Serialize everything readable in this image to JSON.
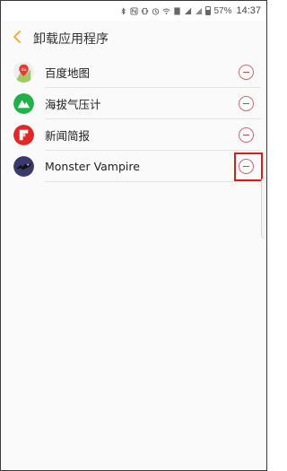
{
  "status_bar": {
    "battery_percent": "57%",
    "time": "14:37",
    "icons": [
      "bluetooth-icon",
      "nfc-icon",
      "vibrate-icon",
      "alarm-icon",
      "wifi-icon",
      "sim-icon",
      "signal-icon",
      "battery-icon"
    ]
  },
  "header": {
    "title": "卸载应用程序",
    "back_icon": "chevron-left-icon"
  },
  "apps": [
    {
      "name": "百度地图",
      "icon": "baidu-maps-icon",
      "color": "#e8e8e8"
    },
    {
      "name": "海拔气压计",
      "icon": "altimeter-icon",
      "color": "#22b04b"
    },
    {
      "name": "新闻简报",
      "icon": "flipboard-icon",
      "color": "#e02828"
    },
    {
      "name": "Monster Vampire",
      "icon": "monster-vampire-icon",
      "color": "#3a3a6a"
    }
  ],
  "colors": {
    "accent": "#f5a623",
    "remove": "#d04848",
    "highlight": "#e01818"
  }
}
